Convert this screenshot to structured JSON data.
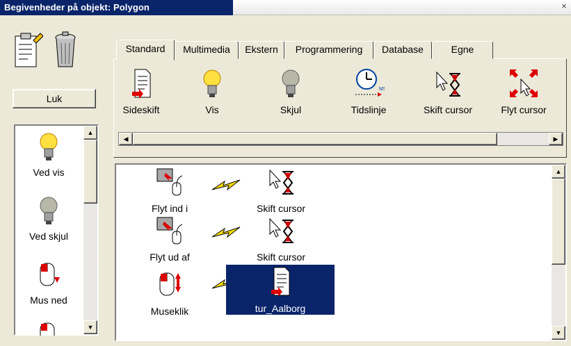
{
  "window": {
    "title": "Begivenheder på objekt: Polygon",
    "close_glyph": "×"
  },
  "left_panel": {
    "top_icons": [
      "notepad-edit-icon",
      "trash-can-icon"
    ],
    "close_button": "Luk",
    "items": [
      {
        "label": "Ved vis",
        "icon": "lightbulb-lit-icon"
      },
      {
        "label": "Ved skjul",
        "icon": "lightbulb-unlit-icon"
      },
      {
        "label": "Mus ned",
        "icon": "mouse-down-icon"
      },
      {
        "label": "",
        "icon": "mouse-partial-icon"
      }
    ]
  },
  "tabs": [
    "Standard",
    "Multimedia",
    "Ekstern",
    "Programmering",
    "Database",
    "Egne"
  ],
  "active_tab": "Standard",
  "tools": [
    {
      "label": "Sideskift",
      "icon": "page-break-icon"
    },
    {
      "label": "Vis",
      "icon": "lightbulb-lit-icon"
    },
    {
      "label": "Skjul",
      "icon": "lightbulb-unlit-icon"
    },
    {
      "label": "Tidslinje",
      "icon": "timeline-clock-icon"
    },
    {
      "label": "Skift cursor",
      "icon": "cursor-hourglass-icon"
    },
    {
      "label": "Flyt cursor",
      "icon": "move-cursor-icon"
    }
  ],
  "events": [
    {
      "trigger": "Flyt ind i",
      "action": "Skift cursor",
      "selected": false
    },
    {
      "trigger": "Flyt ud af",
      "action": "Skift cursor",
      "selected": false
    },
    {
      "trigger": "Museklik",
      "action": "tur_Aalborg",
      "selected": true
    }
  ],
  "colors": {
    "selection": "#0a246a",
    "face": "#ece9d8"
  }
}
